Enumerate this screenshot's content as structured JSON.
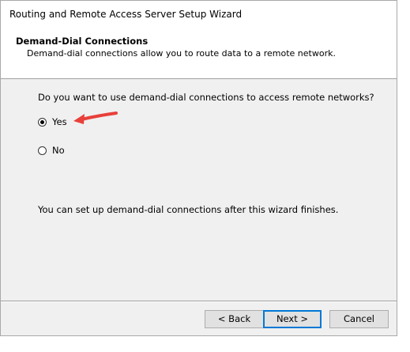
{
  "window": {
    "title": "Routing and Remote Access Server Setup Wizard"
  },
  "header": {
    "heading": "Demand-Dial Connections",
    "subheading": "Demand-dial connections allow you to route data to a remote network."
  },
  "main": {
    "question": "Do you want to use demand-dial connections to access remote networks?",
    "options": [
      {
        "label": "Yes",
        "selected": true
      },
      {
        "label": "No",
        "selected": false
      }
    ],
    "info": "You can set up demand-dial connections after this wizard finishes."
  },
  "footer": {
    "back_label": "< Back",
    "next_label": "Next >",
    "cancel_label": "Cancel"
  },
  "colors": {
    "annotation_arrow": "#e8403a",
    "focus_border": "#0078d7"
  }
}
